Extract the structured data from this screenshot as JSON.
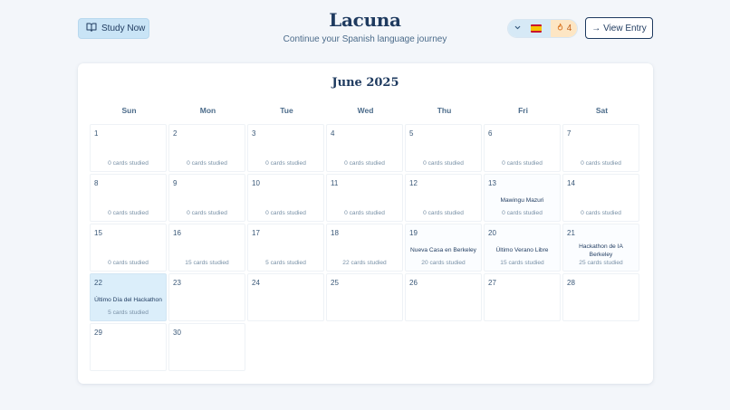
{
  "header": {
    "study_button": {
      "label": "Study Now",
      "icon": "book-open-icon"
    },
    "title": "Lacuna",
    "subtitle": "Continue your Spanish language journey",
    "language": {
      "flag": "🇪🇸",
      "icon": "chevron-down-icon"
    },
    "streak": {
      "icon": "flame-icon",
      "count": "4"
    },
    "view_entry_button": {
      "label": "→ View Entry"
    }
  },
  "calendar": {
    "month_label": "June 2025",
    "weekdays": [
      "Sun",
      "Mon",
      "Tue",
      "Wed",
      "Thu",
      "Fri",
      "Sat"
    ],
    "leading_blanks": 0,
    "days": [
      {
        "num": "1",
        "entry": "",
        "cards": "0 cards studied"
      },
      {
        "num": "2",
        "entry": "",
        "cards": "0 cards studied"
      },
      {
        "num": "3",
        "entry": "",
        "cards": "0 cards studied"
      },
      {
        "num": "4",
        "entry": "",
        "cards": "0 cards studied"
      },
      {
        "num": "5",
        "entry": "",
        "cards": "0 cards studied"
      },
      {
        "num": "6",
        "entry": "",
        "cards": "0 cards studied"
      },
      {
        "num": "7",
        "entry": "",
        "cards": "0 cards studied"
      },
      {
        "num": "8",
        "entry": "",
        "cards": "0 cards studied"
      },
      {
        "num": "9",
        "entry": "",
        "cards": "0 cards studied"
      },
      {
        "num": "10",
        "entry": "",
        "cards": "0 cards studied"
      },
      {
        "num": "11",
        "entry": "",
        "cards": "0 cards studied"
      },
      {
        "num": "12",
        "entry": "",
        "cards": "0 cards studied"
      },
      {
        "num": "13",
        "entry": "Mawingu Mazuri",
        "cards": "0 cards studied"
      },
      {
        "num": "14",
        "entry": "",
        "cards": "0 cards studied"
      },
      {
        "num": "15",
        "entry": "",
        "cards": "0 cards studied"
      },
      {
        "num": "16",
        "entry": "",
        "cards": "15 cards studied"
      },
      {
        "num": "17",
        "entry": "",
        "cards": "5 cards studied"
      },
      {
        "num": "18",
        "entry": "",
        "cards": "22 cards studied"
      },
      {
        "num": "19",
        "entry": "Nueva Casa en Berkeley",
        "cards": "20 cards studied"
      },
      {
        "num": "20",
        "entry": "Último Verano Libre",
        "cards": "15 cards studied"
      },
      {
        "num": "21",
        "entry": "Hackathon de IA Berkeley",
        "cards": "25 cards studied"
      },
      {
        "num": "22",
        "entry": "Último Día del Hackathon",
        "cards": "5 cards studied",
        "today": true
      },
      {
        "num": "23",
        "entry": "",
        "cards": ""
      },
      {
        "num": "24",
        "entry": "",
        "cards": ""
      },
      {
        "num": "25",
        "entry": "",
        "cards": ""
      },
      {
        "num": "26",
        "entry": "",
        "cards": ""
      },
      {
        "num": "27",
        "entry": "",
        "cards": ""
      },
      {
        "num": "28",
        "entry": "",
        "cards": ""
      },
      {
        "num": "29",
        "entry": "",
        "cards": ""
      },
      {
        "num": "30",
        "entry": "",
        "cards": ""
      }
    ]
  }
}
